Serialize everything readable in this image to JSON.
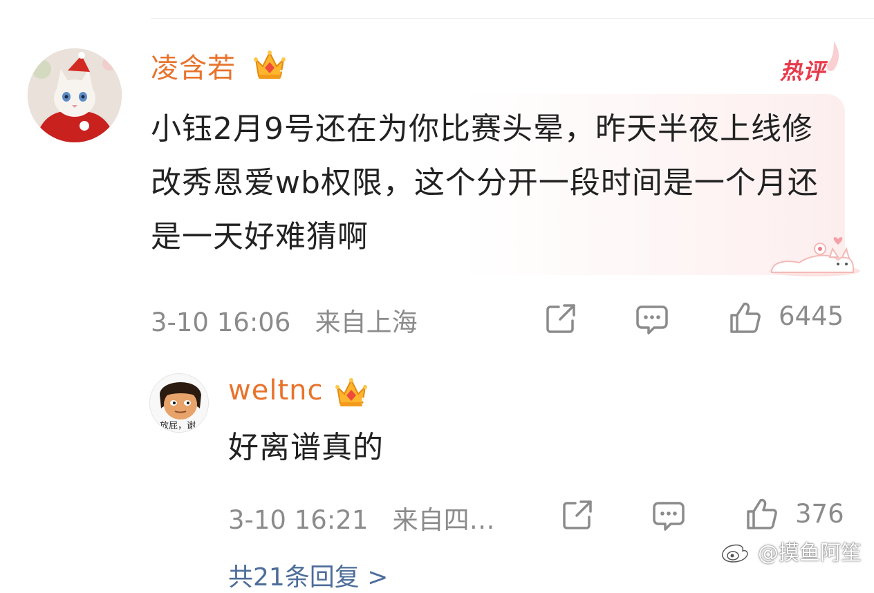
{
  "colors": {
    "username": "#e8732c",
    "meta": "#8b8b8b",
    "hot_badge": "#e8394a",
    "link": "#4d6d9a"
  },
  "main_comment": {
    "username": "凌含若",
    "badge_icon": "crown-level-7-icon",
    "badge_level": "7",
    "hot_label": "热评",
    "text": "小钰2月9号还在为你比赛头晕，昨天半夜上线修改秀恩爱wb权限，这个分开一段时间是一个月还是一天好难猜啊",
    "timestamp": "3-10 16:06",
    "location": "来自上海",
    "like_count": "6445",
    "icons": [
      "share-icon",
      "comment-icon",
      "like-icon"
    ]
  },
  "reply": {
    "username": "weltnc",
    "badge_icon": "crown-level-5-icon",
    "badge_level": "5",
    "avatar_caption": "放屁，谢",
    "text": "好离谱真的",
    "timestamp": "3-10 16:21",
    "location": "来自四…",
    "like_count": "376",
    "icons": [
      "share-icon",
      "comment-icon",
      "like-icon"
    ]
  },
  "more_replies": {
    "label": "共21条回复 >"
  },
  "watermark": {
    "text": "@摸鱼阿笙"
  }
}
